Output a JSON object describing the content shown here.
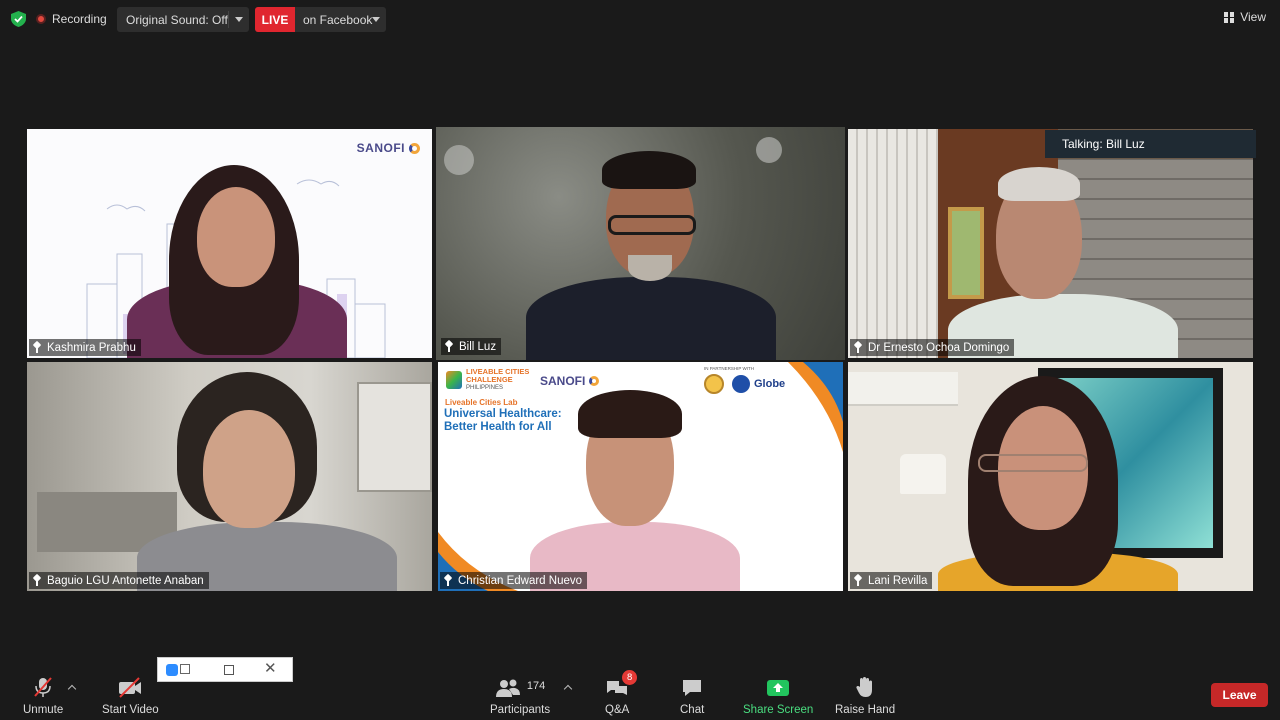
{
  "topbar": {
    "recording_label": "Recording",
    "original_sound_label": "Original Sound: Off",
    "live_badge": "LIVE",
    "live_target": "on Facebook",
    "view_label": "View"
  },
  "talking_indicator": "Talking: Bill Luz",
  "participants": [
    {
      "name": "Kashmira Prabhu"
    },
    {
      "name": "Bill Luz"
    },
    {
      "name": "Dr Ernesto Ochoa Domingo"
    },
    {
      "name": "Baguio LGU Antonette Anaban"
    },
    {
      "name": "Christian Edward Nuevo"
    },
    {
      "name": "Lani Revilla"
    }
  ],
  "slide": {
    "brand": "SANOFI",
    "challenge_line1": "LIVEABLE CITIES",
    "challenge_line2": "CHALLENGE",
    "challenge_line3": "PHILIPPINES",
    "lab": "Liveable Cities Lab",
    "title1": "Universal Healthcare:",
    "title2": "Better Health for All",
    "partnership": "IN PARTNERSHIP WITH",
    "partner": "Globe"
  },
  "tile1_brand": "SANOFI",
  "toolbar": {
    "unmute": "Unmute",
    "start_video": "Start Video",
    "participants_label": "Participants",
    "participants_count": "174",
    "qa": "Q&A",
    "qa_badge": "8",
    "chat": "Chat",
    "share_screen": "Share Screen",
    "raise_hand": "Raise Hand",
    "leave": "Leave"
  },
  "colors": {
    "active_speaker_border": "#d8e89a",
    "live_red": "#e0262f",
    "share_green": "#4ade80",
    "leave_red": "#c62828"
  }
}
